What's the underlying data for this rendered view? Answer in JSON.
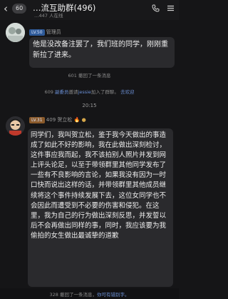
{
  "header": {
    "back_label": "‹",
    "unread_count": "60",
    "title": "…流互助群(496)",
    "subtitle": "…447 人在线",
    "call_icon": "phone-icon",
    "more_icon": "menu-icon"
  },
  "messages": [
    {
      "level": "LV.50",
      "sender": "管理员",
      "text": "他是没改备注罢了，我们班的同学，刚刚重新拉了进来。"
    }
  ],
  "notices": {
    "recall_601": "601 撤回了一条消息",
    "join_prefix": "609",
    "join_inviter": "副委员",
    "join_middle": "邀请",
    "join_target": "jessie",
    "join_suffix": "加入了群聊。",
    "join_action": "去欢迎",
    "time": "20:15",
    "recall_bottom": "328 撤回了一条消息，",
    "recall_bottom_suffix": "你可有错别字。"
  },
  "main_message": {
    "level": "LV.31",
    "sender": "409 贺立松",
    "text": "同学们，我叫贺立松，鉴于我今天做出的事造成了如此不好的影响，我在此做出深刻检讨，这件事应我而起，我不该拍别人照片并发到网上评头论足，以至于带领群里其他同学发布了一些有不良影响的言论，如果我没有因为一时口快而说出这样的话，并带领群里其他成员继续将这个事件持续发展下去，这位女同学也不会因此而遭受到不必要的伤害和侵犯。在这里，我为自己的行为做出深刻反思，并发誓以后不会再做出同样的事，同时，我应该要为我偷拍的女生做出最诚挚的道歉"
  }
}
